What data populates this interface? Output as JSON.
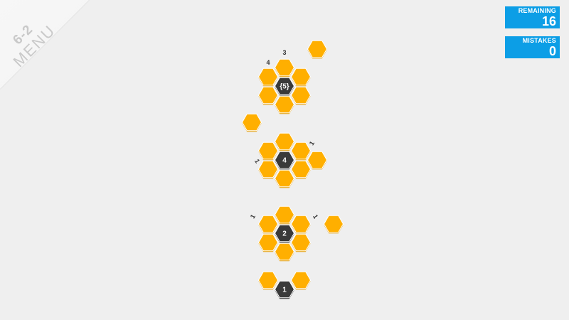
{
  "menu": {
    "level": "6-2",
    "label": "MENU"
  },
  "stats": {
    "remaining_label": "REMAINING",
    "remaining_value": "16",
    "mistakes_label": "MISTAKES",
    "mistakes_value": "0"
  },
  "colors": {
    "background": "#efefef",
    "orange_cell": "#ffaf00",
    "orange_shadow": "#e29a00",
    "black_cell": "#3a3a3a",
    "black_shadow": "#222222",
    "stat_box": "#0c9ee6"
  },
  "cells": {
    "black": [
      {
        "id": "b1",
        "label": "{5}"
      },
      {
        "id": "b2",
        "label": "4"
      },
      {
        "id": "b3",
        "label": "2"
      },
      {
        "id": "b4",
        "label": "1"
      }
    ]
  },
  "column_hints": [
    {
      "id": "h1",
      "label": "4"
    },
    {
      "id": "h2",
      "label": "3"
    },
    {
      "id": "h3",
      "label": "1"
    },
    {
      "id": "h4",
      "label": "1"
    },
    {
      "id": "h5",
      "label": "1"
    },
    {
      "id": "h6",
      "label": "1"
    }
  ]
}
